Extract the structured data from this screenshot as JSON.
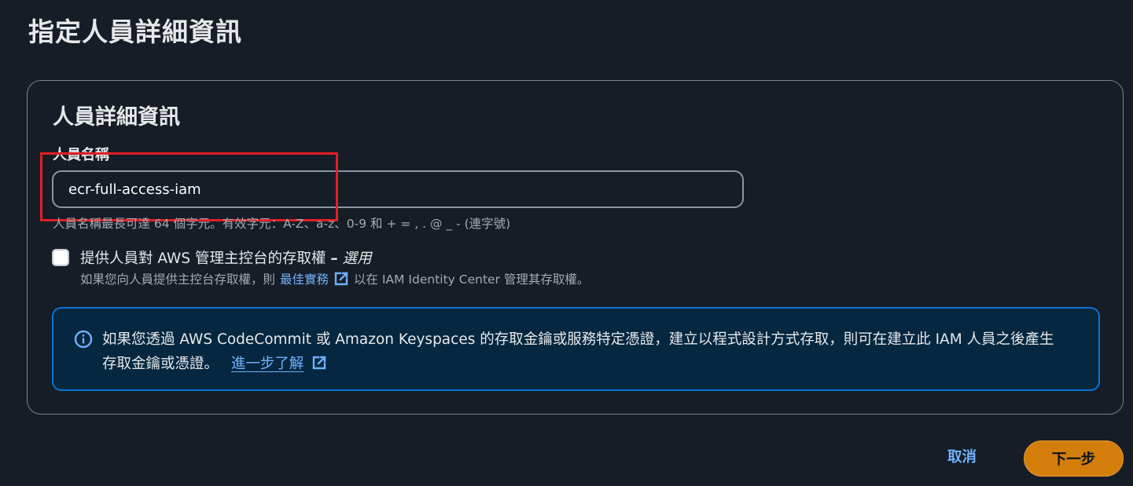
{
  "page": {
    "title": "指定人員詳細資訊"
  },
  "panel": {
    "title": "人員詳細資訊",
    "username": {
      "label": "人員名稱",
      "value": "ecr-full-access-iam",
      "constraint": "人員名稱最長可達 64 個字元。有效字元：A-Z、a-z、0-9 和 + = , . @ _ - (連字號)"
    },
    "console_access": {
      "checked": false,
      "label": "提供人員對 AWS 管理主控台的存取權",
      "dash": "–",
      "optional": "選用",
      "desc_before": "如果您向人員提供主控台存取權，則",
      "desc_link": "最佳實務",
      "desc_after": "以在 IAM Identity Center 管理其存取權。"
    },
    "info": {
      "text": "如果您透過 AWS CodeCommit 或 Amazon Keyspaces 的存取金鑰或服務特定憑證，建立以程式設計方式存取，則可在建立此 IAM 人員之後產生存取金鑰或憑證。",
      "link": "進一步了解"
    }
  },
  "footer": {
    "cancel_label": "取消",
    "next_label": "下一步"
  },
  "colors": {
    "background": "#161d26",
    "link": "#6fb1ff",
    "primary_button": "#d37d0a",
    "info_border": "#0973d8",
    "info_background": "#05273f",
    "highlight": "#e21f26"
  },
  "icons": [
    "external-link-icon",
    "info-icon"
  ]
}
